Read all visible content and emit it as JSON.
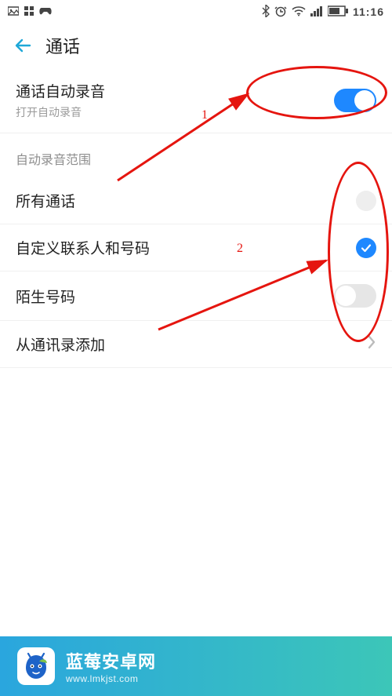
{
  "status": {
    "time": "11:16"
  },
  "header": {
    "title": "通话"
  },
  "autoRecord": {
    "title": "通话自动录音",
    "sub": "打开自动录音",
    "on": true
  },
  "scope": {
    "label": "自动录音范围",
    "items": [
      {
        "label": "所有通话",
        "checked": false,
        "kind": "radio"
      },
      {
        "label": "自定义联系人和号码",
        "checked": true,
        "kind": "radio"
      },
      {
        "label": "陌生号码",
        "checked": false,
        "kind": "toggle"
      }
    ]
  },
  "addFromContacts": {
    "label": "从通讯录添加"
  },
  "annotations": {
    "num1": "1",
    "num2": "2"
  },
  "watermark": {
    "title": "蓝莓安卓网",
    "url": "www.lmkjst.com"
  }
}
